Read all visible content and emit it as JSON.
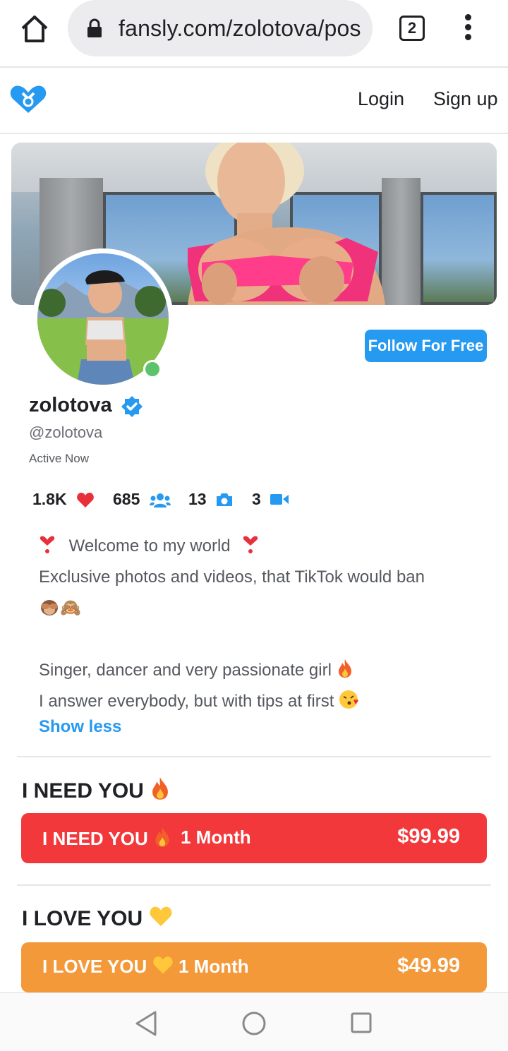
{
  "browser": {
    "url": "fansly.com/zolotova/pos",
    "tab_count": "2"
  },
  "header": {
    "login_label": "Login",
    "signup_label": "Sign up"
  },
  "profile": {
    "display_name": "zolotova",
    "handle": "@zolotova",
    "status": "Active Now",
    "follow_label": "Follow For Free",
    "online_color": "#5cc26b"
  },
  "stats": {
    "likes": "1.8K",
    "followers": "685",
    "photos": "13",
    "videos": "3"
  },
  "bio": {
    "line1": "Welcome to my world",
    "line2": "Exclusive photos and videos, that TikTok would ban",
    "line3": "🙈",
    "line4": "Singer, dancer and very passionate girl",
    "line5": "I answer everybody, but with tips at first",
    "toggle_label": "Show less"
  },
  "tiers": [
    {
      "title": "I NEED YOU",
      "button_name": "I NEED YOU",
      "duration": "1 Month",
      "price": "$99.99",
      "color": "#f2383a"
    },
    {
      "title": "I LOVE YOU",
      "button_name": "I LOVE YOU",
      "duration": "1 Month",
      "price": "$49.99",
      "color": "#f4993a"
    }
  ],
  "colors": {
    "accent": "#2699f0",
    "heart": "#e8303a"
  },
  "icons": [
    "home-icon",
    "lock-icon",
    "tabs-icon",
    "menu-icon",
    "fansly-logo-icon",
    "verified-icon",
    "heart-icon",
    "followers-icon",
    "camera-icon",
    "video-icon",
    "back-icon",
    "nav-home-icon",
    "recents-icon"
  ]
}
